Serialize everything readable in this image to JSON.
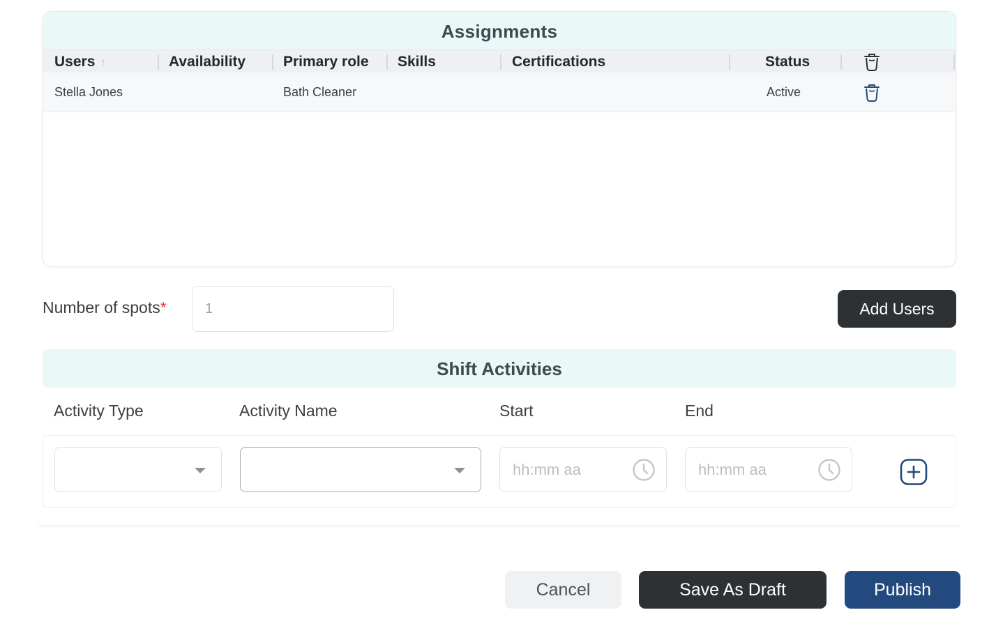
{
  "assignments": {
    "title": "Assignments",
    "columns": {
      "users": "Users",
      "availability": "Availability",
      "primary_role": "Primary role",
      "skills": "Skills",
      "certifications": "Certifications",
      "status": "Status"
    },
    "sort_icon": "arrow-up-icon",
    "header_action_icon": "trash-icon",
    "rows": [
      {
        "user": "Stella Jones",
        "availability": "",
        "primary_role": "Bath Cleaner",
        "skills": "",
        "certifications": "",
        "status": "Active",
        "action_icon": "trash-icon"
      }
    ]
  },
  "spots": {
    "label": "Number of spots",
    "required_mark": "*",
    "value": "1"
  },
  "add_users_label": "Add Users",
  "shift_activities": {
    "title": "Shift Activities",
    "columns": {
      "activity_type": "Activity Type",
      "activity_name": "Activity Name",
      "start": "Start",
      "end": "End"
    },
    "row": {
      "activity_type": "",
      "activity_name": "",
      "start_placeholder": "hh:mm aa",
      "end_placeholder": "hh:mm aa",
      "add_icon": "plus-square-icon"
    }
  },
  "footer": {
    "cancel_label": "Cancel",
    "save_draft_label": "Save As Draft",
    "publish_label": "Publish"
  },
  "colors": {
    "header_bg": "#eaf8f8",
    "dark_button": "#2d3134",
    "publish_button": "#234a7e",
    "required": "#e0334a",
    "icon_blue": "#234a7e"
  }
}
